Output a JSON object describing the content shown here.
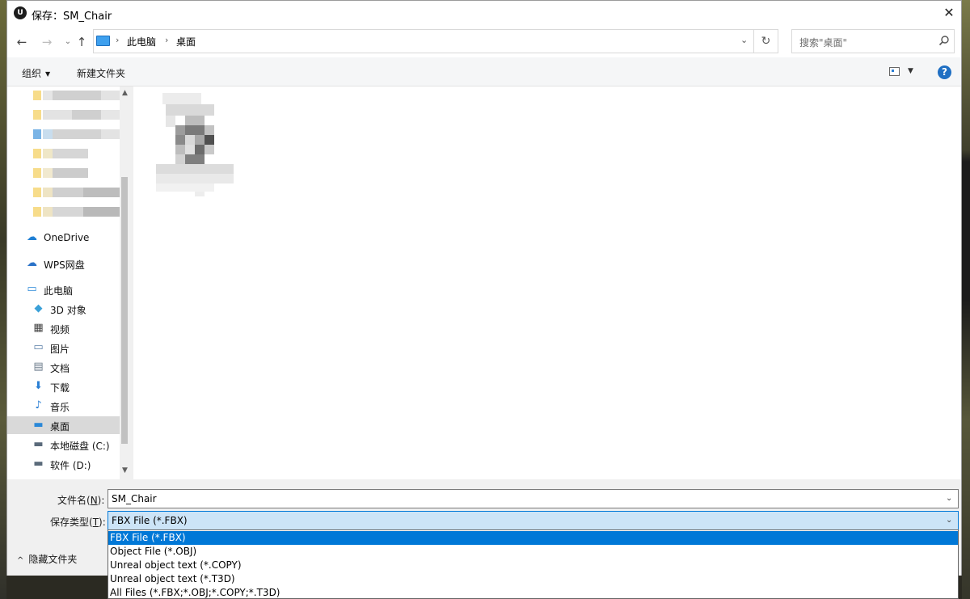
{
  "window": {
    "title": "保存：SM_Chair",
    "app_icon_text": "U",
    "close_symbol": "✕"
  },
  "address": {
    "crumbs": [
      "此电脑",
      "桌面"
    ],
    "separator": "›",
    "search_placeholder": "搜索\"桌面\""
  },
  "toolbar": {
    "organize_label": "组织",
    "new_folder_label": "新建文件夹",
    "help_symbol": "?"
  },
  "navpane": {
    "items": [
      {
        "label": "OneDrive",
        "icon": "cloud-icon"
      },
      {
        "label": "WPS网盘",
        "icon": "cloud-outline-icon"
      },
      {
        "label": "此电脑",
        "icon": "computer-icon"
      },
      {
        "label": "3D 对象",
        "icon": "cube-icon"
      },
      {
        "label": "视频",
        "icon": "film-icon"
      },
      {
        "label": "图片",
        "icon": "picture-icon"
      },
      {
        "label": "文档",
        "icon": "document-icon"
      },
      {
        "label": "下载",
        "icon": "download-arrow-icon"
      },
      {
        "label": "音乐",
        "icon": "music-note-icon"
      },
      {
        "label": "桌面",
        "icon": "desktop-icon",
        "selected": true
      },
      {
        "label": "本地磁盘 (C:)",
        "icon": "drive-icon"
      },
      {
        "label": "软件 (D:)",
        "icon": "drive-icon"
      }
    ]
  },
  "bottom": {
    "filename_label": "文件名(",
    "filename_key": "N",
    "filename_label_end": "):",
    "filename_value": "SM_Chair",
    "type_label": "保存类型(",
    "type_key": "T",
    "type_label_end": "):",
    "type_value": "FBX File (*.FBX)",
    "hide_folders_label": "隐藏文件夹"
  },
  "dropdown": {
    "options": [
      {
        "label": "FBX File (*.FBX)",
        "selected": true
      },
      {
        "label": "Object File (*.OBJ)",
        "selected": false
      },
      {
        "label": "Unreal object text (*.COPY)",
        "selected": false
      },
      {
        "label": "Unreal object text (*.T3D)",
        "selected": false
      },
      {
        "label": "All Files (*.FBX;*.OBJ;*.COPY;*.T3D)",
        "selected": false
      }
    ]
  },
  "colors": {
    "accent": "#0078d7",
    "selection_bg": "#cce4f7",
    "nav_selected": "#d9d9d9"
  }
}
